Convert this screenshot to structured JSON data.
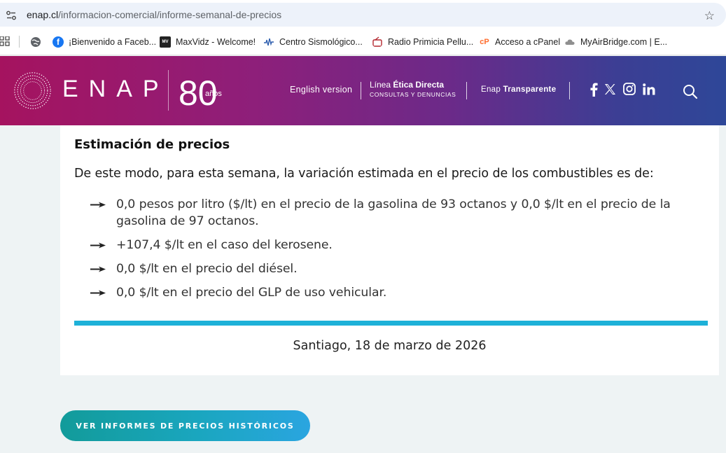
{
  "browser": {
    "url_host": "enap.cl",
    "url_path": "/informacion-comercial/informe-semanal-de-precios",
    "bookmarks": [
      {
        "label": "¡Bienvenido a Faceb...",
        "icon": "facebook-icon"
      },
      {
        "label": "MaxVidz - Welcome!",
        "icon": "maxvidz-icon"
      },
      {
        "label": "Centro Sismológico...",
        "icon": "csn-icon"
      },
      {
        "label": "Radio Primicia Pellu...",
        "icon": "radio-icon"
      },
      {
        "label": "Acceso a cPanel",
        "icon": "cpanel-icon"
      },
      {
        "label": "MyAirBridge.com | E...",
        "icon": "cloud-icon"
      }
    ]
  },
  "header": {
    "logo_text": "ENAP",
    "anniversary_number": "80",
    "anniversary_word": "años",
    "english_version": "English version",
    "linea_prefix": "Línea ",
    "linea_bold": "Ética Directa",
    "linea_sub": "CONSULTAS Y DENUNCIAS",
    "transparencia_prefix": "Enap ",
    "transparencia_bold": "Transparente",
    "colors": {
      "gradient_start": "#a5135f",
      "gradient_end": "#2e4798"
    }
  },
  "content": {
    "section_title": "Estimación de precios",
    "intro": "De este modo, para esta semana, la  variación estimada en el precio de los combustibles es de:",
    "bullets": [
      "0,0 pesos por litro ($/lt) en el precio de la gasolina de 93 octanos y 0,0 $/lt en el precio de la gasolina de 97 octanos.",
      "+107,4 $/lt en el caso del kerosene.",
      "0,0 $/lt en el precio del diésel.",
      "0,0 $/lt en el precio del GLP de uso vehicular."
    ],
    "dateline": "Santiago, 18 de marzo de 2026",
    "rule_color": "#1eb1d8"
  },
  "cta": {
    "label": "VER INFORMES DE PRECIOS HISTÓRICOS"
  }
}
